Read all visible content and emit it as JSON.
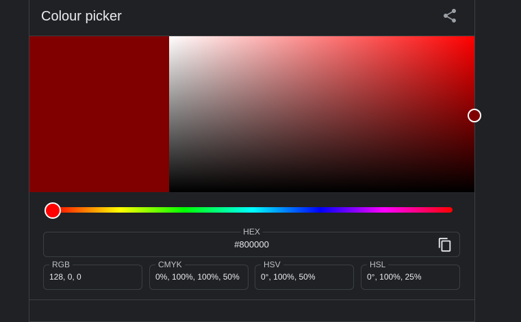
{
  "header": {
    "title": "Colour picker",
    "share_icon": "share-icon"
  },
  "picker": {
    "selected_color": "#800000",
    "hue_color": "#ff0000",
    "hue_level_percent": 0,
    "saturation_percent": 100,
    "value_percent": 50
  },
  "hex": {
    "label": "HEX",
    "value": "#800000",
    "copy_icon": "copy-icon"
  },
  "fields": [
    {
      "label": "RGB",
      "value": "128, 0, 0"
    },
    {
      "label": "CMYK",
      "value": "0%, 100%, 100%, 50%"
    },
    {
      "label": "HSV",
      "value": "0°, 100%, 50%"
    },
    {
      "label": "HSL",
      "value": "0°, 100%, 25%"
    }
  ],
  "colors": {
    "background": "#202124",
    "border": "#3c4043",
    "text": "#e8eaed",
    "label": "#bdc1c6"
  }
}
